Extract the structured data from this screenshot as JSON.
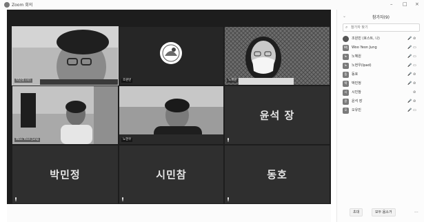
{
  "window": {
    "title": "Zoom 회의",
    "minimize": "–",
    "maximize": "□",
    "close": "×"
  },
  "tiles": [
    {
      "name": "박민정 (나)",
      "kind": "video",
      "selected": true
    },
    {
      "name": "조원빈",
      "kind": "logo"
    },
    {
      "name": "노혜원",
      "kind": "video"
    },
    {
      "name": "Woo Yeon Jung",
      "kind": "video"
    },
    {
      "name": "노현우",
      "kind": "video"
    },
    {
      "name": "",
      "display": "윤석 장",
      "kind": "text"
    },
    {
      "name": "",
      "display": "박민정",
      "kind": "text"
    },
    {
      "name": "",
      "display": "시민참",
      "kind": "text"
    },
    {
      "name": "",
      "display": "동호",
      "kind": "text"
    }
  ],
  "panel": {
    "title": "참가자(9)",
    "search_placeholder": "참가자 찾기",
    "participants": [
      {
        "initial": "",
        "name": "조원빈 (호스트, 나)",
        "mic": "🎤",
        "cam": "⊘"
      },
      {
        "initial": "WJ",
        "name": "Woo Yeon Jung",
        "mic": "🎤",
        "cam": "▭"
      },
      {
        "initial": "노",
        "name": "노혜원",
        "mic": "🎤",
        "cam": "▭"
      },
      {
        "initial": "노",
        "name": "노현우(Ipad)",
        "mic": "🎤",
        "cam": "▭"
      },
      {
        "initial": "동",
        "name": "동호",
        "mic": "🎤",
        "cam": "⊘"
      },
      {
        "initial": "박",
        "name": "박민정",
        "mic": "🎤",
        "cam": "⊘"
      },
      {
        "initial": "시",
        "name": "시민참",
        "mic": "",
        "cam": "⊘"
      },
      {
        "initial": "윤",
        "name": "윤석 장",
        "mic": "🎤",
        "cam": "⊘"
      },
      {
        "initial": "오",
        "name": "오유빈",
        "mic": "🎤",
        "cam": "▭"
      }
    ],
    "invite_label": "초대",
    "mute_all_label": "모두 음소거",
    "more_label": "..."
  },
  "colors": {
    "meeting_bg": "#1d1d1d",
    "tile_bg": "#2f2f2f",
    "panel_bg": "#fcfcfc"
  }
}
